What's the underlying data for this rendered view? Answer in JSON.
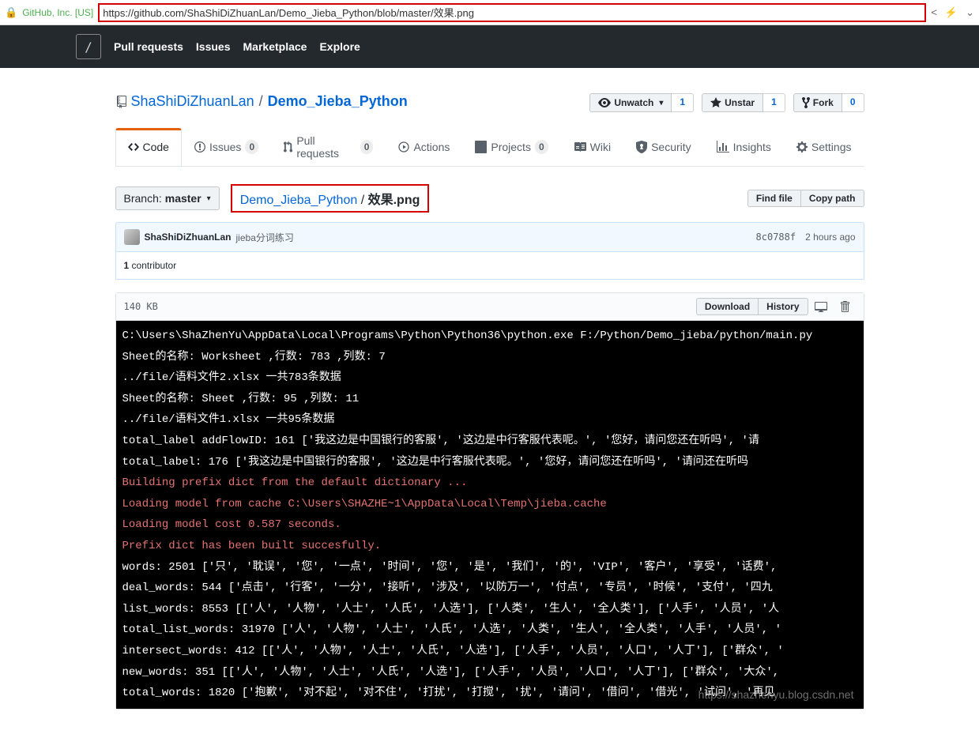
{
  "addr": {
    "org": "GitHub, Inc. [US]",
    "url": "https://github.com/ShaShiDiZhuanLan/Demo_Jieba_Python/blob/master/效果.png"
  },
  "nav": {
    "pull": "Pull requests",
    "issues": "Issues",
    "market": "Marketplace",
    "explore": "Explore",
    "logo": "/"
  },
  "repo": {
    "owner": "ShaShiDiZhuanLan",
    "name": "Demo_Jieba_Python",
    "sep": "/"
  },
  "actions": {
    "watch": "Unwatch",
    "watch_n": "1",
    "star": "Unstar",
    "star_n": "1",
    "fork": "Fork",
    "fork_n": "0"
  },
  "tabs": {
    "code": "Code",
    "issues": "Issues",
    "issues_n": "0",
    "pr": "Pull requests",
    "pr_n": "0",
    "actions": "Actions",
    "proj": "Projects",
    "proj_n": "0",
    "wiki": "Wiki",
    "sec": "Security",
    "ins": "Insights",
    "set": "Settings"
  },
  "branch": {
    "label": "Branch:",
    "name": "master"
  },
  "crumb": {
    "root": "Demo_Jieba_Python",
    "sep": " / ",
    "file": "效果.png"
  },
  "btns": {
    "find": "Find file",
    "copy": "Copy path",
    "download": "Download",
    "history": "History"
  },
  "commit": {
    "author": "ShaShiDiZhuanLan",
    "msg": "jieba分词练习",
    "sha": "8c0788f",
    "time": "2 hours ago"
  },
  "contrib": {
    "n": "1",
    "label": " contributor"
  },
  "file": {
    "size": "140 KB"
  },
  "term": {
    "l1": "C:\\Users\\ShaZhenYu\\AppData\\Local\\Programs\\Python\\Python36\\python.exe F:/Python/Demo_jieba/python/main.py",
    "l2": "Sheet的名称: Worksheet ,行数: 783 ,列数: 7",
    "l3": "../file/语料文件2.xlsx 一共783条数据",
    "l4": "Sheet的名称: Sheet ,行数: 95 ,列数: 11",
    "l5": "../file/语料文件1.xlsx 一共95条数据",
    "l6": "total_label addFlowID: 161 ['我这边是中国银行的客服', '这边是中行客服代表呢。', '您好，请问您还在听吗', '请",
    "l7": "total_label: 176 ['我这边是中国银行的客服', '这边是中行客服代表呢。', '您好，请问您还在听吗', '请问还在听吗",
    "e1": "Building prefix dict from the default dictionary ...",
    "e2": "Loading model from cache C:\\Users\\SHAZHE~1\\AppData\\Local\\Temp\\jieba.cache",
    "e3": "Loading model cost 0.587 seconds.",
    "e4": "Prefix dict has been built succesfully.",
    "l8": "words: 2501 ['只', '耽误', '您', '一点', '时间', '您', '是', '我们', '的', 'VIP', '客户', '享受', '话费',",
    "l9": "deal_words: 544 ['点击', '行客', '一分', '接听', '涉及', '以防万一', '付点', '专员', '时候', '支付', '四九",
    "l10": "list_words: 8553 [['人', '人物', '人士', '人氏', '人选'], ['人类', '生人', '全人类'], ['人手', '人员', '人",
    "l11": "total_list_words: 31970 ['人', '人物', '人士', '人氏', '人选', '人类', '生人', '全人类', '人手', '人员', '",
    "l12": "intersect_words: 412 [['人', '人物', '人士', '人氏', '人选'], ['人手', '人员', '人口', '人丁'], ['群众', '",
    "l13": "new_words: 351 [['人', '人物', '人士', '人氏', '人选'], ['人手', '人员', '人口', '人丁'], ['群众', '大众',",
    "l14": "total_words: 1820 ['抱歉', '对不起', '对不住', '打扰', '打搅', '扰', '请问', '借问', '借光', '试问', '再见"
  },
  "watermark": "https://shazhenyu.blog.csdn.net"
}
